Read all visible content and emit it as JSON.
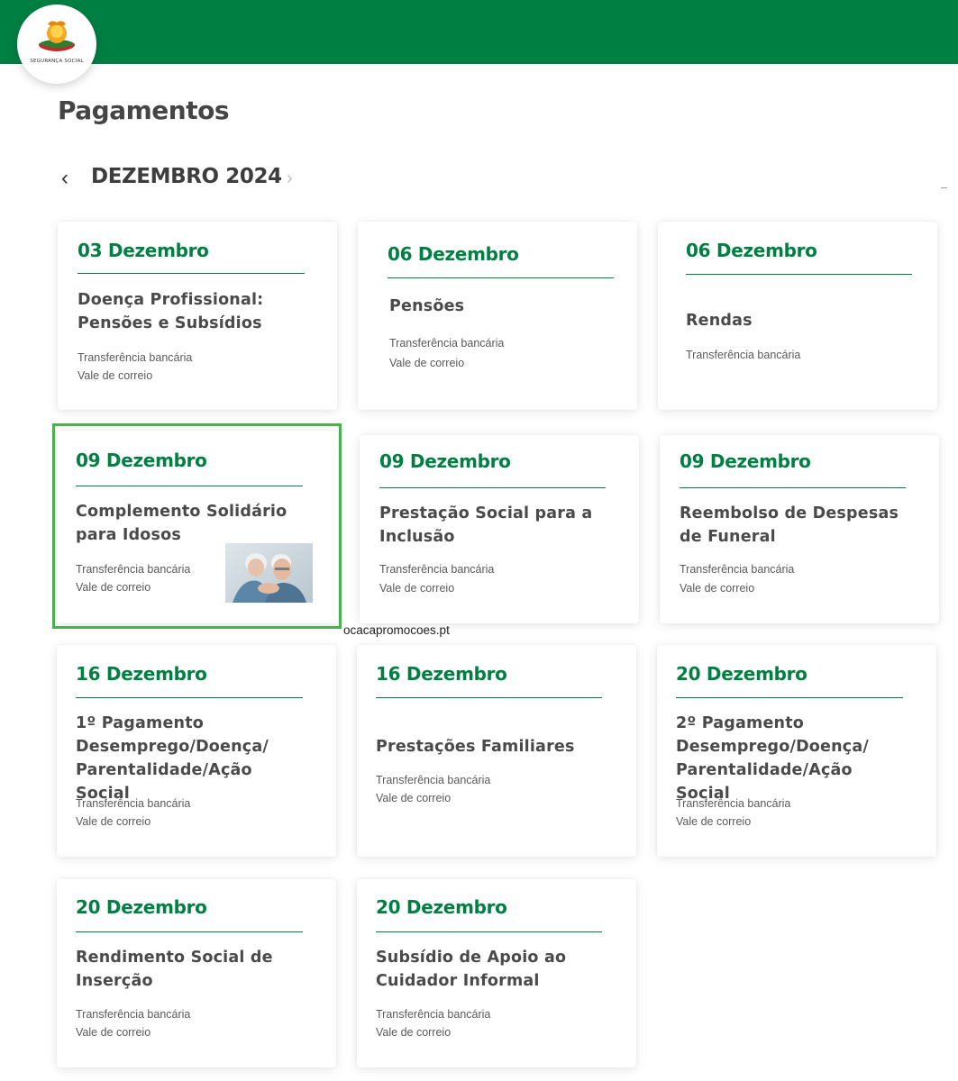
{
  "header": {
    "logo_text": "SEGURANÇA SOCIAL",
    "brand_color": "#007f43"
  },
  "page": {
    "title": "Pagamentos"
  },
  "month_nav": {
    "label": "DEZEMBRO 2024",
    "prev_icon": "chevron-left-icon",
    "next_icon": "chevron-right-icon"
  },
  "cards": [
    {
      "date": "03 Dezembro",
      "title": "Doença Profissional: Pensões e Subsídios",
      "methods": [
        "Transferência bancária",
        "Vale de correio"
      ]
    },
    {
      "date": "06 Dezembro",
      "title": "Pensões",
      "methods": [
        "Transferência bancária",
        "Vale de correio"
      ]
    },
    {
      "date": "06 Dezembro",
      "title": "Rendas",
      "methods": [
        "Transferência bancária"
      ]
    },
    {
      "date": "09 Dezembro",
      "title": "Complemento Solidário para Idosos",
      "methods": [
        "Transferência bancária",
        "Vale de correio"
      ],
      "highlighted": true
    },
    {
      "date": "09 Dezembro",
      "title": "Prestação Social para a Inclusão",
      "methods": [
        "Transferência bancária",
        "Vale de correio"
      ]
    },
    {
      "date": "09 Dezembro",
      "title": "Reembolso de Despesas de Funeral",
      "methods": [
        "Transferência bancária",
        "Vale de correio"
      ]
    },
    {
      "date": "16 Dezembro",
      "title": "1º Pagamento Desemprego/Doença/ Parentalidade/Ação Social",
      "methods": [
        "Transferência bancária",
        "Vale de correio"
      ]
    },
    {
      "date": "16 Dezembro",
      "title": "Prestações Familiares",
      "methods": [
        "Transferência bancária",
        "Vale de correio"
      ]
    },
    {
      "date": "20 Dezembro",
      "title": "2º Pagamento Desemprego/Doença/ Parentalidade/Ação Social",
      "methods": [
        "Transferência bancária",
        "Vale de correio"
      ]
    },
    {
      "date": "20 Dezembro",
      "title": "Rendimento Social de Inserção",
      "methods": [
        "Transferência bancária",
        "Vale de correio"
      ]
    },
    {
      "date": "20 Dezembro",
      "title": "Subsídio de Apoio ao Cuidador Informal",
      "methods": [
        "Transferência bancária",
        "Vale de correio"
      ]
    }
  ],
  "overlay": {
    "watermark": "ocacapromocoes.pt",
    "photo_icon": "elderly-couple-photo",
    "highlight_color": "#4caf50"
  }
}
